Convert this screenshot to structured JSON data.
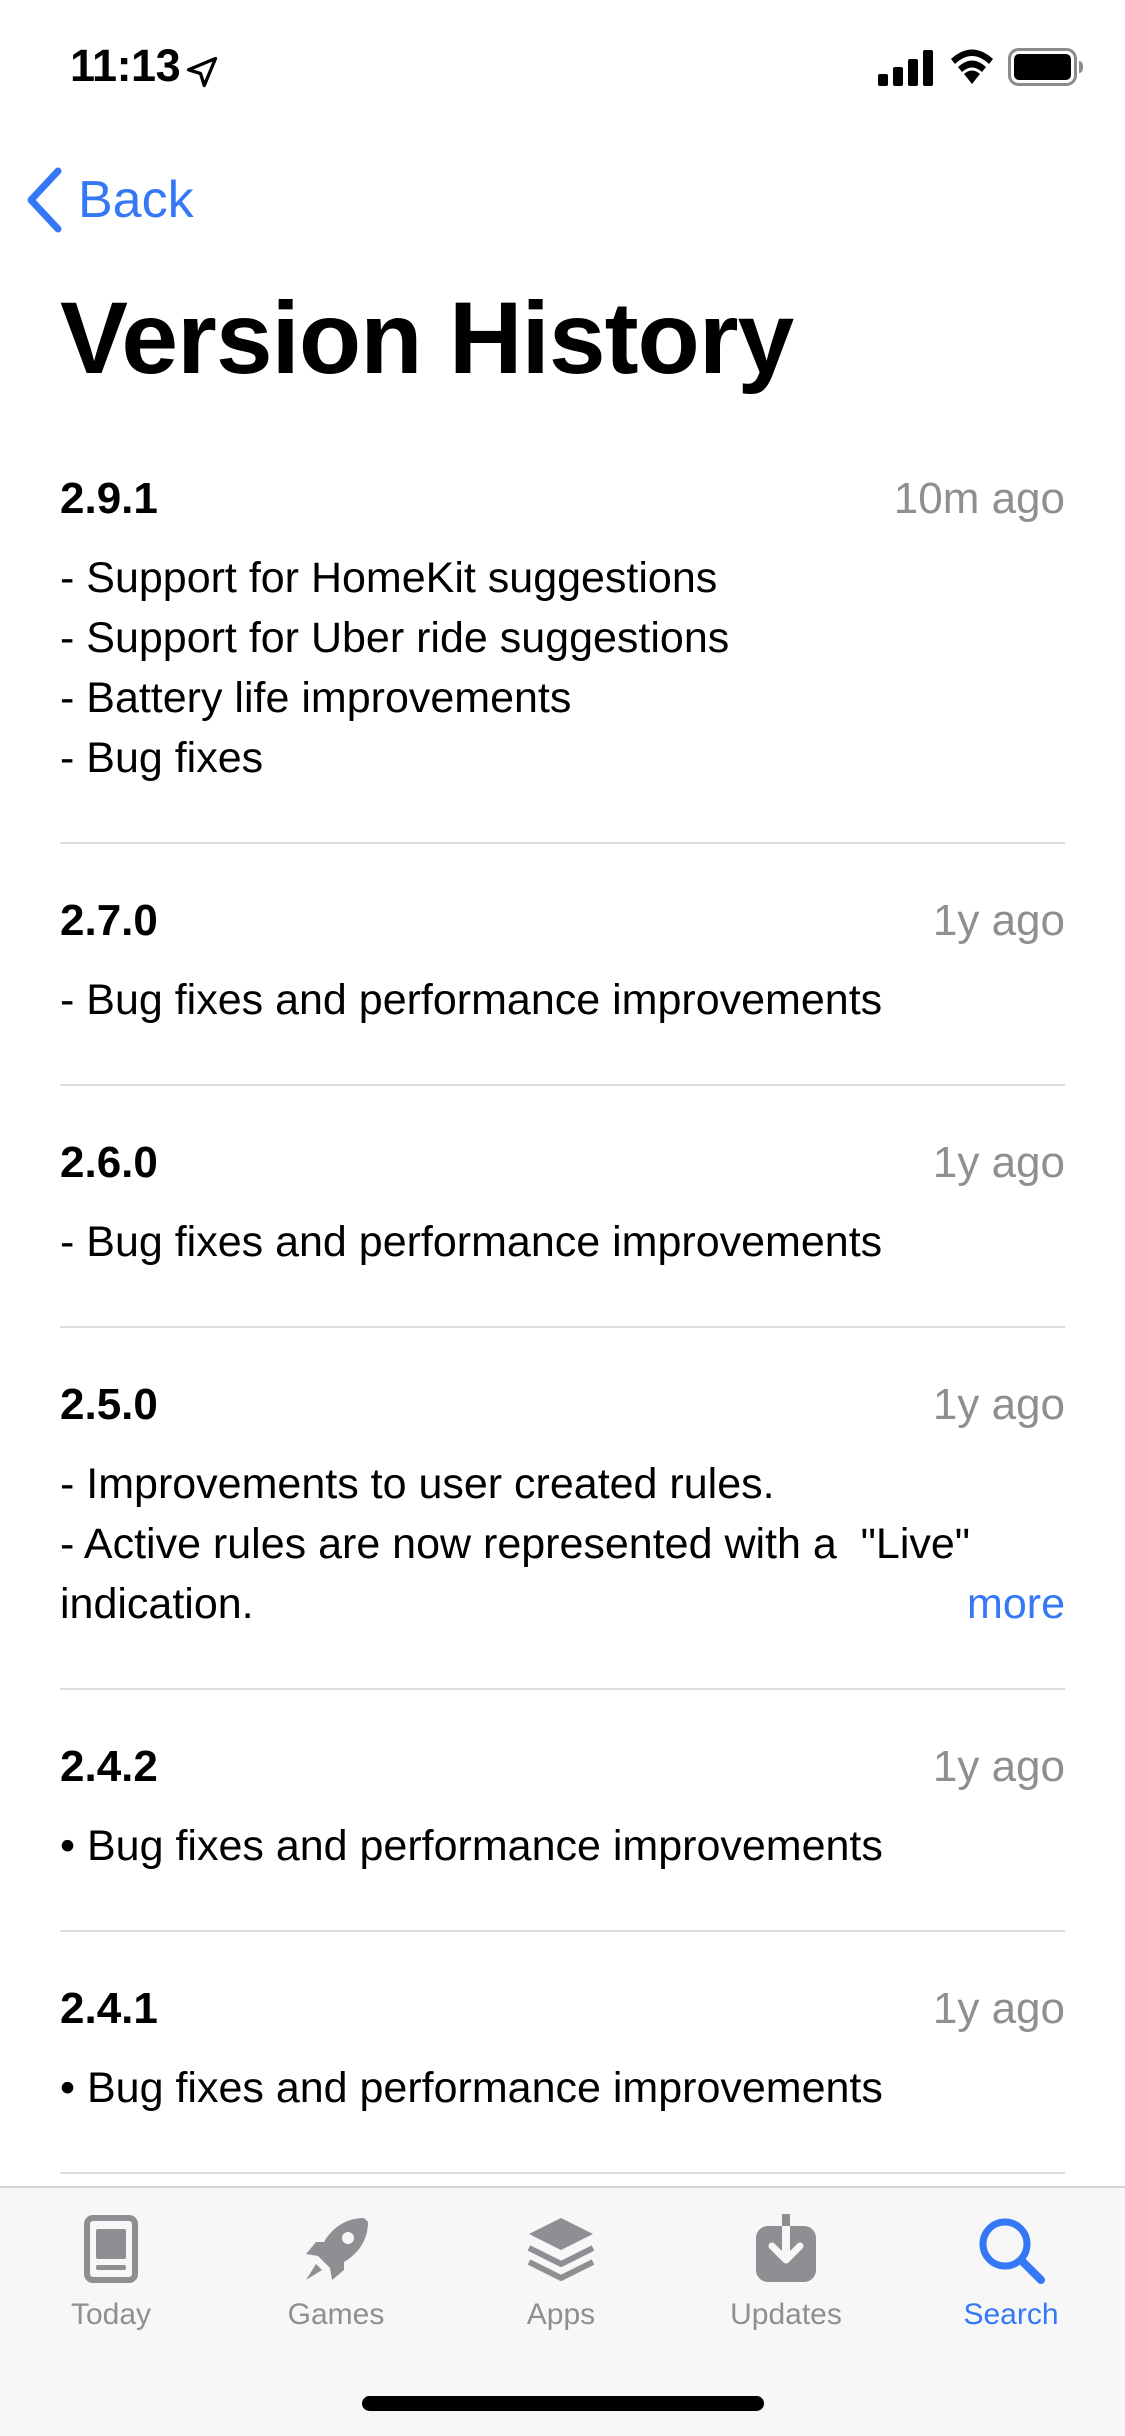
{
  "status_bar": {
    "time": "11:13",
    "location_icon": "location-arrow-icon",
    "signal_icon": "cellular-signal-icon",
    "wifi_icon": "wifi-icon",
    "battery_icon": "battery-icon"
  },
  "nav": {
    "back_label": "Back",
    "back_icon": "chevron-left-icon"
  },
  "page": {
    "title": "Version History"
  },
  "versions": [
    {
      "number": "2.9.1",
      "date": "10m ago",
      "notes": [
        "- Support for HomeKit suggestions",
        "- Support for Uber ride suggestions",
        "- Battery life improvements",
        "- Bug fixes"
      ]
    },
    {
      "number": "2.7.0",
      "date": "1y ago",
      "notes": [
        "- Bug fixes and performance improvements"
      ]
    },
    {
      "number": "2.6.0",
      "date": "1y ago",
      "notes": [
        "- Bug fixes and performance improvements"
      ]
    },
    {
      "number": "2.5.0",
      "date": "1y ago",
      "notes": [
        "- Improvements to user created rules.",
        "- Active rules are now represented with a  \"Live\"",
        "indication."
      ],
      "more_label": "more"
    },
    {
      "number": "2.4.2",
      "date": "1y ago",
      "notes": [
        "• Bug fixes and performance improvements"
      ]
    },
    {
      "number": "2.4.1",
      "date": "1y ago",
      "notes": [
        "• Bug fixes and performance improvements"
      ]
    }
  ],
  "tab_bar": {
    "tabs": [
      {
        "label": "Today",
        "icon": "today-icon",
        "active": false
      },
      {
        "label": "Games",
        "icon": "rocket-icon",
        "active": false
      },
      {
        "label": "Apps",
        "icon": "layers-icon",
        "active": false
      },
      {
        "label": "Updates",
        "icon": "download-icon",
        "active": false
      },
      {
        "label": "Search",
        "icon": "search-icon",
        "active": true
      }
    ]
  },
  "colors": {
    "accent": "#3478f6",
    "secondary_text": "#8e8e93",
    "separator": "#dcdcdf",
    "tab_bar_bg": "#f7f7f7"
  }
}
